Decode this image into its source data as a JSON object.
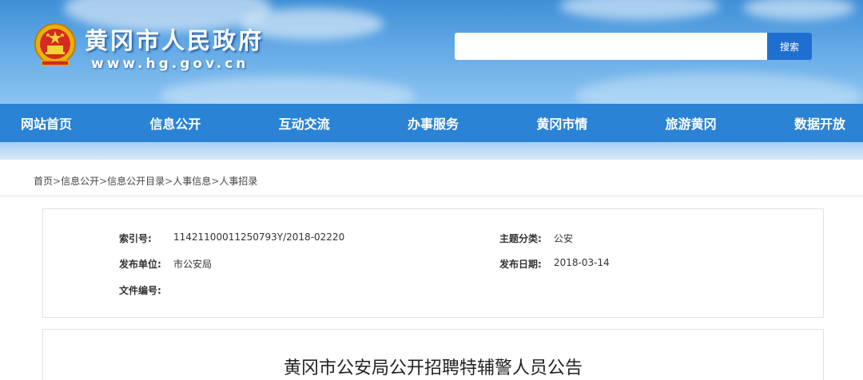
{
  "header": {
    "site_title": "黄冈市人民政府",
    "site_url": "www.hg.gov.cn",
    "search_placeholder": "",
    "search_button": "搜索"
  },
  "nav": {
    "items": [
      "网站首页",
      "信息公开",
      "互动交流",
      "办事服务",
      "黄冈市情",
      "旅游黄冈",
      "数据开放"
    ]
  },
  "breadcrumb": {
    "items": [
      "首页",
      "信息公开",
      "信息公开目录",
      "人事信息",
      "人事招录"
    ],
    "separator": ">"
  },
  "info": {
    "index_label": "索引号:",
    "index_value": "11421100011250793Y/2018-02220",
    "topic_label": "主题分类:",
    "topic_value": "公安",
    "publisher_label": "发布单位:",
    "publisher_value": "市公安局",
    "date_label": "发布日期:",
    "date_value": "2018-03-14",
    "doc_no_label": "文件编号:",
    "doc_no_value": ""
  },
  "article": {
    "title": "黄冈市公安局公开招聘特辅警人员公告"
  },
  "colors": {
    "nav_bg": "#2a83d4",
    "search_button_bg": "#1f6fd0",
    "banner_top": "#3f8fd8",
    "banner_bottom": "#8cc4f0"
  }
}
